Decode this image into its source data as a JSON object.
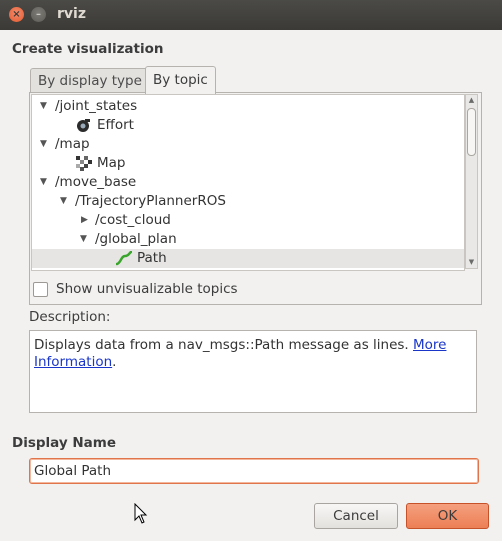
{
  "window": {
    "title": "rviz",
    "close_glyph": "×",
    "minimize_glyph": "–"
  },
  "create_visualization": {
    "heading": "Create visualization",
    "tabs": [
      {
        "label": "By display type",
        "active": false
      },
      {
        "label": "By topic",
        "active": true
      }
    ],
    "tree": [
      {
        "label": "/joint_states",
        "expanded": true,
        "kind": "topic"
      },
      {
        "label": "Effort",
        "kind": "display",
        "icon": "effort-icon"
      },
      {
        "label": "/map",
        "expanded": true,
        "kind": "topic"
      },
      {
        "label": "Map",
        "kind": "display",
        "icon": "map-icon"
      },
      {
        "label": "/move_base",
        "expanded": true,
        "kind": "topic"
      },
      {
        "label": "/TrajectoryPlannerROS",
        "expanded": true,
        "kind": "topic"
      },
      {
        "label": "/cost_cloud",
        "expanded": false,
        "kind": "topic"
      },
      {
        "label": "/global_plan",
        "expanded": true,
        "kind": "topic"
      },
      {
        "label": "Path",
        "kind": "display",
        "icon": "path-icon",
        "selected": true
      }
    ],
    "show_unvisualizable": {
      "label": "Show unvisualizable topics",
      "checked": false
    }
  },
  "description": {
    "label": "Description:",
    "text": "Displays data from a nav_msgs::Path message as lines. ",
    "link_text": "More Information",
    "trailing": "."
  },
  "display_name": {
    "heading": "Display Name",
    "value": "Global Path"
  },
  "buttons": {
    "cancel": "Cancel",
    "ok": "OK"
  },
  "colors": {
    "accent": "#ec7f55",
    "title_bar": "#3c3b37",
    "link": "#1a36c9",
    "path_icon": "#3aa52c"
  }
}
